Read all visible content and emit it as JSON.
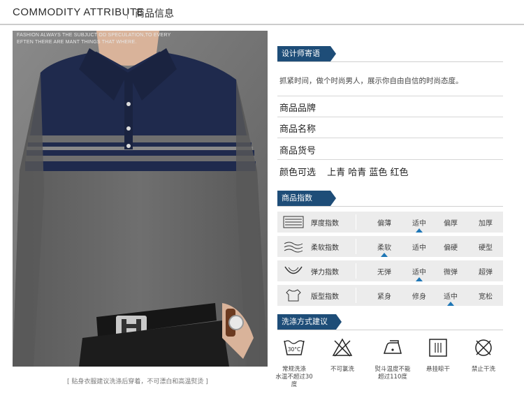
{
  "header": {
    "title": "COMMODITY ATTRIBUTE",
    "title_cn": "商品信息"
  },
  "photo": {
    "fashion_line1": "FASHION ALWAYS THE  SUBJUCT OD SPECULATION,TO EVERY",
    "fashion_line2": "EFTEN THERE ARE MANT THINGS THAT WHERE."
  },
  "caption": "[  贴身衣服建议洗涤后穿着，不可漂白和高温熨烫  ]",
  "designer": {
    "tag": "设计师寄语",
    "text": "抓紧时间，做个时尚男人，展示你自由自信的时尚态度。"
  },
  "info": {
    "brand": "商品品牌",
    "name": "商品名称",
    "sku": "商品货号",
    "color_label": "颜色可选",
    "colors": "上青 哈青 蓝色 红色"
  },
  "index": {
    "tag": "商品指数",
    "rows": [
      {
        "label": "厚度指数",
        "options": [
          "偏薄",
          "适中",
          "偏厚",
          "加厚"
        ],
        "selected": 1
      },
      {
        "label": "柔软指数",
        "options": [
          "柔软",
          "适中",
          "偏硬",
          "硬型"
        ],
        "selected": 0
      },
      {
        "label": "弹力指数",
        "options": [
          "无弹",
          "适中",
          "微弹",
          "超弹"
        ],
        "selected": 1
      },
      {
        "label": "版型指数",
        "options": [
          "紧身",
          "修身",
          "适中",
          "宽松"
        ],
        "selected": 2
      }
    ]
  },
  "washing": {
    "tag": "洗涤方式建议",
    "items": [
      {
        "icon": "wash-30c-icon",
        "line1": "常规洗涤",
        "line2": "水温不超过30度"
      },
      {
        "icon": "no-bleach-icon",
        "line1": "不可氯洗",
        "line2": ""
      },
      {
        "icon": "iron-icon",
        "line1": "熨斗温度不能",
        "line2": "超过110度"
      },
      {
        "icon": "hang-dry-icon",
        "line1": "悬挂晾干",
        "line2": ""
      },
      {
        "icon": "no-dry-clean-icon",
        "line1": "禁止干洗",
        "line2": ""
      }
    ],
    "wash_temp_text": "30°C"
  },
  "colors": {
    "accent": "#1e4d78",
    "marker": "#1e76b5",
    "navy_stripe": "#1f2a4d",
    "sweater_gray": "#6f6f6f"
  }
}
